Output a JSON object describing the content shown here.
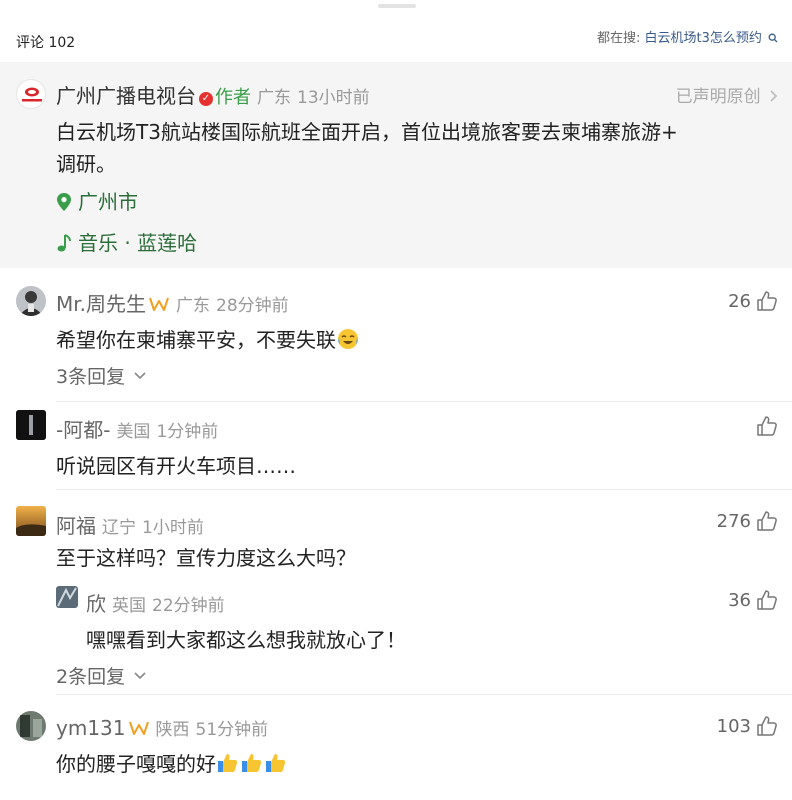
{
  "header": {
    "comment_count": "评论 102",
    "searching_label": "都在搜:",
    "searching_query": "白云机场t3怎么预约"
  },
  "post": {
    "account_name": "广州广播电视台",
    "author_tag": "作者",
    "region": "广东",
    "time": "13小时前",
    "declaration": "已声明原创",
    "body_line1": "白云机场T3航站楼国际航班全面开启，首位出境旅客要去柬埔寨旅游+",
    "body_line2": "调研。",
    "location": "广州市",
    "music": "音乐 · 蓝莲哈"
  },
  "comments": [
    {
      "name": "Mr.周先生",
      "region": "广东",
      "time": "28分钟前",
      "text": "希望你在柬埔寨平安，不要失联",
      "likes": "26",
      "replies": "3条回复"
    },
    {
      "name": "-阿都-",
      "region": "美国",
      "time": "1分钟前",
      "text": "听说园区有开火车项目……",
      "likes": ""
    },
    {
      "name": "阿福",
      "region": "辽宁",
      "time": "1小时前",
      "text": "至于这样吗？宣传力度这么大吗？",
      "likes": "276",
      "replies": "2条回复",
      "reply": {
        "name": "欣",
        "region": "英国",
        "time": "22分钟前",
        "text": "嘿嘿看到大家都这么想我就放心了！",
        "likes": "36"
      }
    },
    {
      "name": "ym131",
      "region": "陕西",
      "time": "51分钟前",
      "text": "你的腰子嘎嘎的好",
      "likes": "103"
    }
  ],
  "colors": {
    "accent_green": "#2c6e3a",
    "author_tag": "#3a9d4a",
    "verified_badge": "#e5312f",
    "crown_badge": "#f0a020",
    "search_link": "#3a5a8c"
  },
  "icons": [
    "search-icon",
    "verified-icon",
    "chevron-right-icon",
    "location-pin-icon",
    "music-note-icon",
    "thumbs-up-icon",
    "crown-badge-icon",
    "chevron-down-icon"
  ]
}
